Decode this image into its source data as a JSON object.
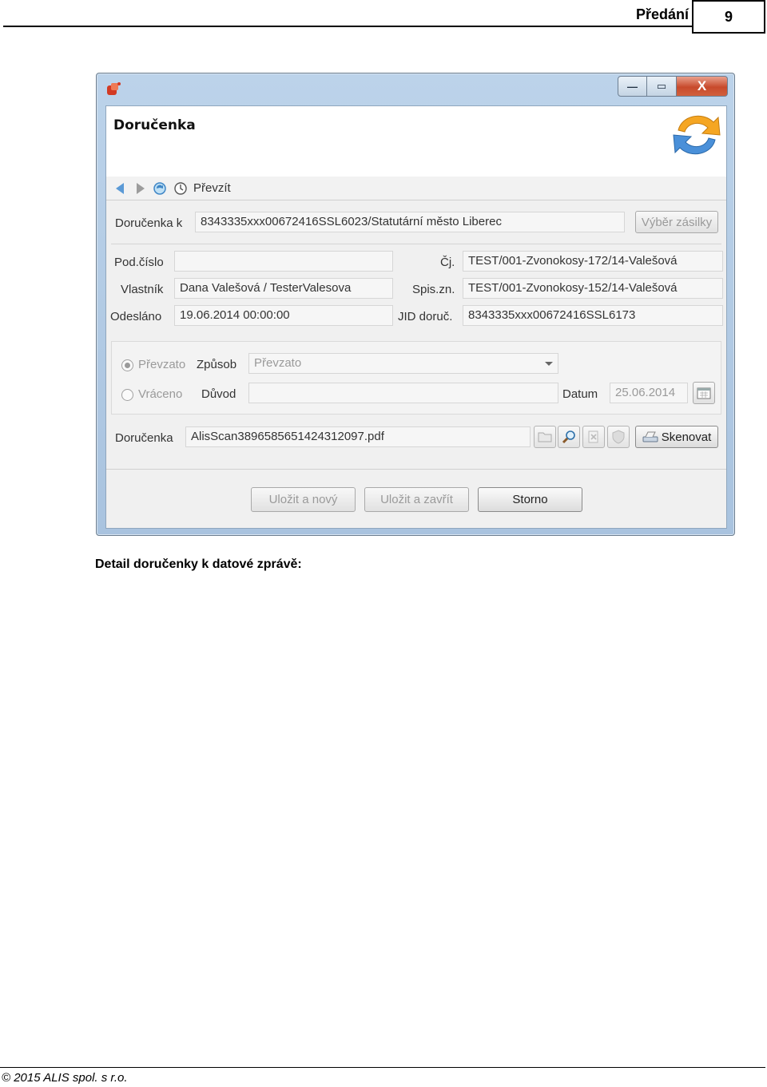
{
  "doc_header": {
    "section_title": "Předání",
    "page_number": "9"
  },
  "window": {
    "buttons": {
      "minimize": "—",
      "maximize": "▭",
      "close": "X"
    },
    "banner_title": "Doručenka",
    "toolbar": {
      "accept_label": "Převzít"
    },
    "form": {
      "delivery_for_label": "Doručenka k",
      "delivery_for_value": "8343335xxx00672416SSL6023/Statutární město Liberec",
      "select_parcel_button": "Výběr zásilky",
      "subnumber_label": "Pod.číslo",
      "subnumber_value": "",
      "ref_number_label": "Čj.",
      "ref_number_value": "TEST/001-Zvonokosy-172/14-Valešová",
      "owner_label": "Vlastník",
      "owner_value": "Dana Valešová / TesterValesova",
      "file_mark_label": "Spis.zn.",
      "file_mark_value": "TEST/001-Zvonokosy-152/14-Valešová",
      "sent_label": "Odesláno",
      "sent_value": "19.06.2014 00:00:00",
      "jid_label": "JID doruč.",
      "jid_value": "8343335xxx00672416SSL6173"
    },
    "status_group": {
      "accepted_radio": "Převzato",
      "method_label": "Způsob",
      "method_value": "Převzato",
      "returned_radio": "Vráceno",
      "reason_label": "Důvod",
      "reason_value": "",
      "date_label": "Datum",
      "date_value": "25.06.2014"
    },
    "file_row": {
      "label": "Doručenka",
      "value": "AlisScan3896585651424312097.pdf",
      "scan_button": "Skenovat"
    },
    "footer_buttons": {
      "save_new": "Uložit a nový",
      "save_close": "Uložit a zavřít",
      "cancel": "Storno"
    }
  },
  "caption": "Detail doručenky k datové zprávě:",
  "page_footer": "© 2015 ALIS spol. s r.o."
}
